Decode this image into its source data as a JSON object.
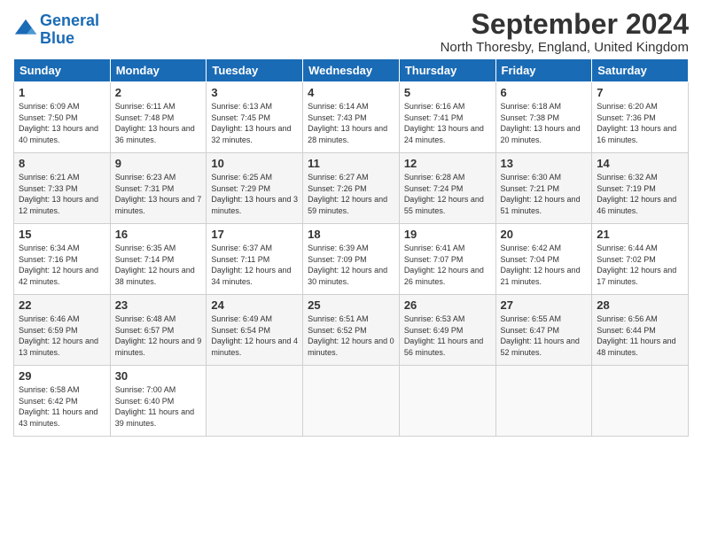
{
  "logo": {
    "line1": "General",
    "line2": "Blue"
  },
  "title": "September 2024",
  "location": "North Thoresby, England, United Kingdom",
  "days_header": [
    "Sunday",
    "Monday",
    "Tuesday",
    "Wednesday",
    "Thursday",
    "Friday",
    "Saturday"
  ],
  "weeks": [
    [
      {
        "day": "1",
        "sunrise": "6:09 AM",
        "sunset": "7:50 PM",
        "daylight": "13 hours and 40 minutes."
      },
      {
        "day": "2",
        "sunrise": "6:11 AM",
        "sunset": "7:48 PM",
        "daylight": "13 hours and 36 minutes."
      },
      {
        "day": "3",
        "sunrise": "6:13 AM",
        "sunset": "7:45 PM",
        "daylight": "13 hours and 32 minutes."
      },
      {
        "day": "4",
        "sunrise": "6:14 AM",
        "sunset": "7:43 PM",
        "daylight": "13 hours and 28 minutes."
      },
      {
        "day": "5",
        "sunrise": "6:16 AM",
        "sunset": "7:41 PM",
        "daylight": "13 hours and 24 minutes."
      },
      {
        "day": "6",
        "sunrise": "6:18 AM",
        "sunset": "7:38 PM",
        "daylight": "13 hours and 20 minutes."
      },
      {
        "day": "7",
        "sunrise": "6:20 AM",
        "sunset": "7:36 PM",
        "daylight": "13 hours and 16 minutes."
      }
    ],
    [
      {
        "day": "8",
        "sunrise": "6:21 AM",
        "sunset": "7:33 PM",
        "daylight": "13 hours and 12 minutes."
      },
      {
        "day": "9",
        "sunrise": "6:23 AM",
        "sunset": "7:31 PM",
        "daylight": "13 hours and 7 minutes."
      },
      {
        "day": "10",
        "sunrise": "6:25 AM",
        "sunset": "7:29 PM",
        "daylight": "13 hours and 3 minutes."
      },
      {
        "day": "11",
        "sunrise": "6:27 AM",
        "sunset": "7:26 PM",
        "daylight": "12 hours and 59 minutes."
      },
      {
        "day": "12",
        "sunrise": "6:28 AM",
        "sunset": "7:24 PM",
        "daylight": "12 hours and 55 minutes."
      },
      {
        "day": "13",
        "sunrise": "6:30 AM",
        "sunset": "7:21 PM",
        "daylight": "12 hours and 51 minutes."
      },
      {
        "day": "14",
        "sunrise": "6:32 AM",
        "sunset": "7:19 PM",
        "daylight": "12 hours and 46 minutes."
      }
    ],
    [
      {
        "day": "15",
        "sunrise": "6:34 AM",
        "sunset": "7:16 PM",
        "daylight": "12 hours and 42 minutes."
      },
      {
        "day": "16",
        "sunrise": "6:35 AM",
        "sunset": "7:14 PM",
        "daylight": "12 hours and 38 minutes."
      },
      {
        "day": "17",
        "sunrise": "6:37 AM",
        "sunset": "7:11 PM",
        "daylight": "12 hours and 34 minutes."
      },
      {
        "day": "18",
        "sunrise": "6:39 AM",
        "sunset": "7:09 PM",
        "daylight": "12 hours and 30 minutes."
      },
      {
        "day": "19",
        "sunrise": "6:41 AM",
        "sunset": "7:07 PM",
        "daylight": "12 hours and 26 minutes."
      },
      {
        "day": "20",
        "sunrise": "6:42 AM",
        "sunset": "7:04 PM",
        "daylight": "12 hours and 21 minutes."
      },
      {
        "day": "21",
        "sunrise": "6:44 AM",
        "sunset": "7:02 PM",
        "daylight": "12 hours and 17 minutes."
      }
    ],
    [
      {
        "day": "22",
        "sunrise": "6:46 AM",
        "sunset": "6:59 PM",
        "daylight": "12 hours and 13 minutes."
      },
      {
        "day": "23",
        "sunrise": "6:48 AM",
        "sunset": "6:57 PM",
        "daylight": "12 hours and 9 minutes."
      },
      {
        "day": "24",
        "sunrise": "6:49 AM",
        "sunset": "6:54 PM",
        "daylight": "12 hours and 4 minutes."
      },
      {
        "day": "25",
        "sunrise": "6:51 AM",
        "sunset": "6:52 PM",
        "daylight": "12 hours and 0 minutes."
      },
      {
        "day": "26",
        "sunrise": "6:53 AM",
        "sunset": "6:49 PM",
        "daylight": "11 hours and 56 minutes."
      },
      {
        "day": "27",
        "sunrise": "6:55 AM",
        "sunset": "6:47 PM",
        "daylight": "11 hours and 52 minutes."
      },
      {
        "day": "28",
        "sunrise": "6:56 AM",
        "sunset": "6:44 PM",
        "daylight": "11 hours and 48 minutes."
      }
    ],
    [
      {
        "day": "29",
        "sunrise": "6:58 AM",
        "sunset": "6:42 PM",
        "daylight": "11 hours and 43 minutes."
      },
      {
        "day": "30",
        "sunrise": "7:00 AM",
        "sunset": "6:40 PM",
        "daylight": "11 hours and 39 minutes."
      },
      null,
      null,
      null,
      null,
      null
    ]
  ]
}
